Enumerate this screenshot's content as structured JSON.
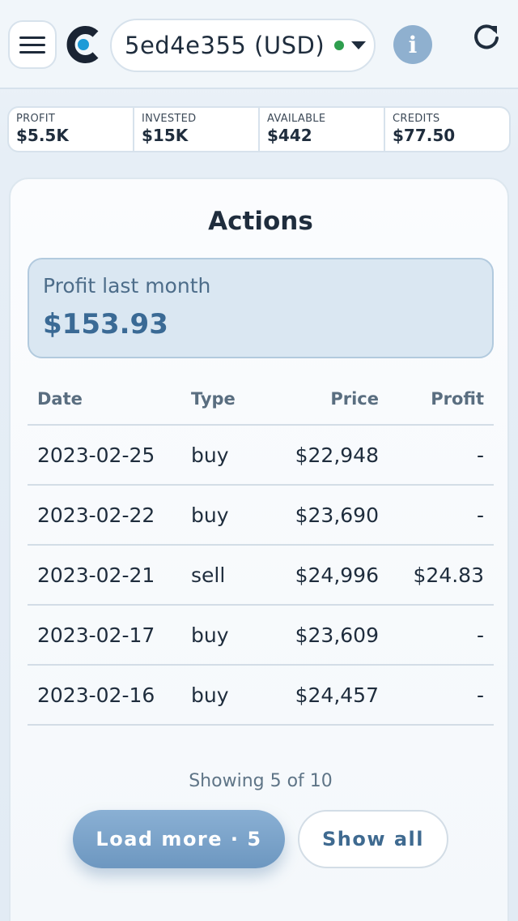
{
  "header": {
    "account": "5ed4e355 (USD)",
    "info_glyph": "i",
    "colors": {
      "status_dot": "#2e9e4e",
      "logo_blue": "#1e9bd7",
      "accent": "#6d97c0"
    }
  },
  "stats": [
    {
      "label": "PROFIT",
      "value": "$5.5K"
    },
    {
      "label": "INVESTED",
      "value": "$15K"
    },
    {
      "label": "AVAILABLE",
      "value": "$442"
    },
    {
      "label": "CREDITS",
      "value": "$77.50"
    }
  ],
  "actions": {
    "title": "Actions",
    "profit_label": "Profit last month",
    "profit_value": "$153.93",
    "columns": [
      "Date",
      "Type",
      "Price",
      "Profit"
    ],
    "rows": [
      {
        "date": "2023-02-25",
        "type": "buy",
        "price": "$22,948",
        "profit": "-"
      },
      {
        "date": "2023-02-22",
        "type": "buy",
        "price": "$23,690",
        "profit": "-"
      },
      {
        "date": "2023-02-21",
        "type": "sell",
        "price": "$24,996",
        "profit": "$24.83"
      },
      {
        "date": "2023-02-17",
        "type": "buy",
        "price": "$23,609",
        "profit": "-"
      },
      {
        "date": "2023-02-16",
        "type": "buy",
        "price": "$24,457",
        "profit": "-"
      }
    ],
    "showing": "Showing 5 of 10",
    "load_more": "Load more · 5",
    "show_all": "Show all"
  }
}
